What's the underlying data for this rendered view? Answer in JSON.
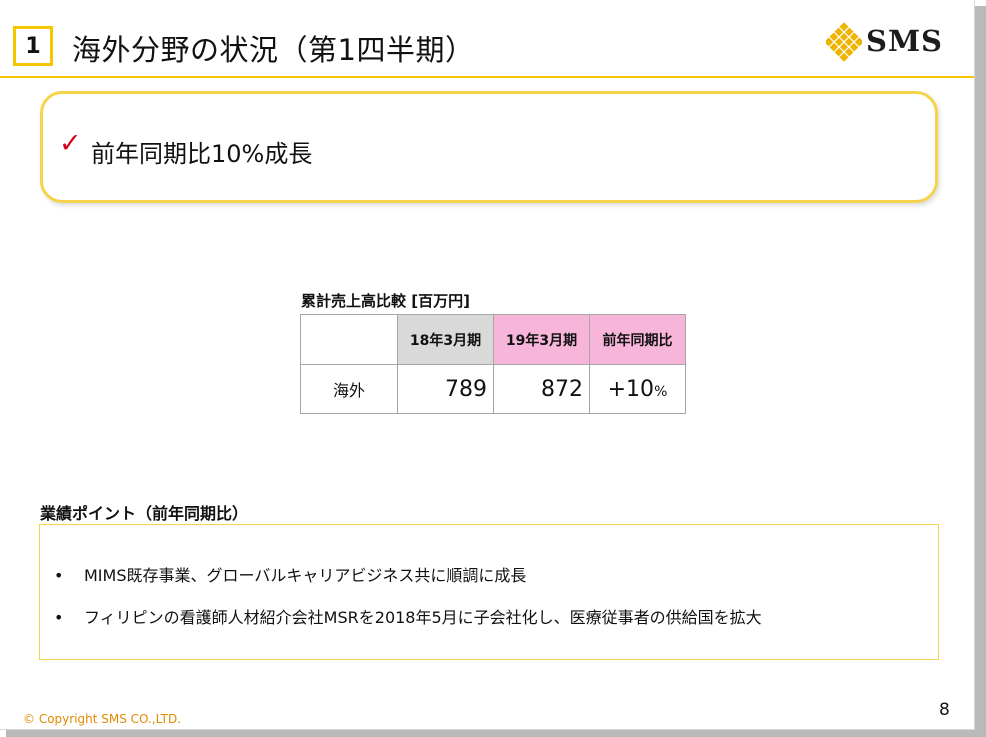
{
  "header": {
    "section_number": "1",
    "title": "海外分野の状況（第1四半期）",
    "logo_text": "SMS"
  },
  "callout": {
    "check_icon": "checkmark-icon",
    "text": "前年同期比10%成長"
  },
  "table": {
    "caption": "累計売上高比較 [百万円]",
    "columns": [
      "",
      "18年3月期",
      "19年3月期",
      "前年同期比"
    ],
    "rows": [
      {
        "label": "海外",
        "fy18": "789",
        "fy19": "872",
        "yoy": "+10",
        "yoy_unit": "%"
      }
    ]
  },
  "points": {
    "title": "業績ポイント（前年同期比）",
    "items": [
      "MIMS既存事業、グローバルキャリアビジネス共に順調に成長",
      "フィリピンの看護師人材紹介会社MSRを2018年5月に子会社化し、医療従事者の供給国を拡大"
    ]
  },
  "footer": {
    "copyright": "© Copyright SMS CO.,LTD.",
    "page_number": "8"
  },
  "colors": {
    "accent_yellow": "#f5c500",
    "check_red": "#d9001b",
    "header_gray": "#d9d9d9",
    "header_pink": "#f7b6d9",
    "copyright_orange": "#e28b00"
  }
}
